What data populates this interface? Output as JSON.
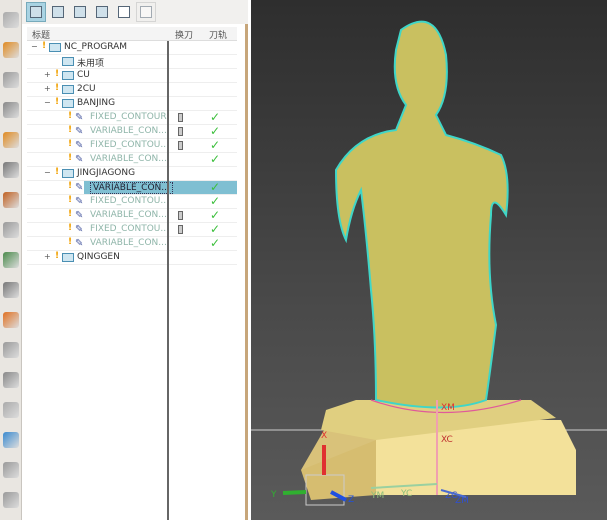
{
  "toolbar": {
    "icons": [
      "program-order-view-icon",
      "machine-tool-view-icon",
      "geometry-view-icon",
      "method-view-icon",
      "create-program-icon",
      "delete-icon"
    ]
  },
  "tree": {
    "headers": {
      "name": "标题",
      "tool_change": "换刀",
      "toolpath": "刀轨"
    },
    "rows": [
      {
        "label": "NC_PROGRAM",
        "type": "group",
        "level": 0,
        "expand": "-"
      },
      {
        "label": "未用项",
        "type": "group",
        "level": 1,
        "expand": ""
      },
      {
        "label": "CU",
        "type": "group",
        "level": 1,
        "expand": "+"
      },
      {
        "label": "2CU",
        "type": "group",
        "level": 1,
        "expand": "+"
      },
      {
        "label": "BANJING",
        "type": "group",
        "level": 1,
        "expand": "-"
      },
      {
        "label": "FIXED_CONTOUR",
        "type": "op",
        "level": 2,
        "tool": true,
        "check": true
      },
      {
        "label": "VARIABLE_CON...",
        "type": "op",
        "level": 2,
        "tool": true,
        "check": true
      },
      {
        "label": "FIXED_CONTOU...",
        "type": "op",
        "level": 2,
        "tool": true,
        "check": true
      },
      {
        "label": "VARIABLE_CON...",
        "type": "op",
        "level": 2,
        "tool": false,
        "check": true
      },
      {
        "label": "JINGJIAGONG",
        "type": "group",
        "level": 1,
        "expand": "-"
      },
      {
        "label": "VARIABLE_CON...",
        "type": "op",
        "level": 2,
        "tool": false,
        "check": true,
        "selected": true
      },
      {
        "label": "FIXED_CONTOU...",
        "type": "op",
        "level": 2,
        "tool": false,
        "check": true
      },
      {
        "label": "VARIABLE_CON...",
        "type": "op",
        "level": 2,
        "tool": true,
        "check": true
      },
      {
        "label": "FIXED_CONTOU...",
        "type": "op",
        "level": 2,
        "tool": true,
        "check": true
      },
      {
        "label": "VARIABLE_CON...",
        "type": "op",
        "level": 2,
        "tool": false,
        "check": true
      },
      {
        "label": "QINGGEN",
        "type": "group",
        "level": 1,
        "expand": "+"
      }
    ]
  },
  "viewport": {
    "labels": {
      "xm": "XM",
      "xc": "XC",
      "ym": "YM",
      "yc": "YC",
      "zc": "ZC",
      "zm": "ZM",
      "x": "X",
      "y": "Y",
      "z": "Z"
    }
  },
  "colors": {
    "selection": "#7fbfd2",
    "model": "#c9c060",
    "blank": "#f3e19a",
    "toolpath": "#3fd6c8"
  }
}
